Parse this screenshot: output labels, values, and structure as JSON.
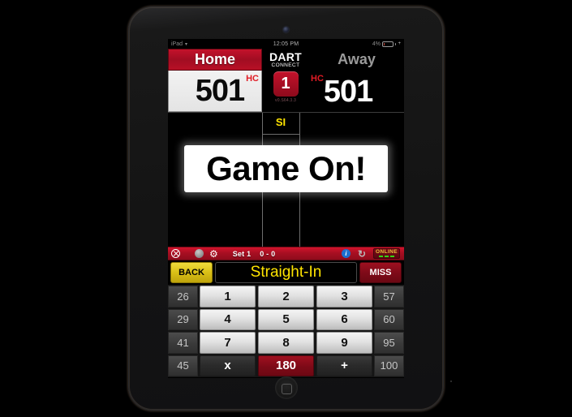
{
  "status_bar": {
    "device": "iPad",
    "wifi_icon": "wifi-icon",
    "time": "12:05 PM",
    "battery_percent": "4%"
  },
  "scoreboard": {
    "home_label": "Home",
    "home_score": "501",
    "home_hc": "HC",
    "brand_top": "DART",
    "brand_bottom": "CONNECT",
    "leg_number": "1",
    "version": "v0.S64.3.3",
    "away_hc": "HC",
    "away_label": "Away",
    "away_score": "501"
  },
  "game_area": {
    "column_marker": "SI",
    "banner_text": "Game On!"
  },
  "toolbar": {
    "close_icon": "close-circle-icon",
    "circle_icon": "circle-icon",
    "gear_icon": "gear-icon",
    "set_label": "Set 1",
    "set_score": "0 - 0",
    "info_icon": "info-icon",
    "refresh_icon": "refresh-icon",
    "online_label": "ONLINE",
    "signal_bars": 3
  },
  "action_row": {
    "back_label": "BACK",
    "mode_label": "Straight-In",
    "miss_label": "MISS"
  },
  "keypad": {
    "rows": [
      {
        "left": "26",
        "keys": [
          "1",
          "2",
          "3"
        ],
        "right": "57"
      },
      {
        "left": "29",
        "keys": [
          "4",
          "5",
          "6"
        ],
        "right": "60"
      },
      {
        "left": "41",
        "keys": [
          "7",
          "8",
          "9"
        ],
        "right": "95"
      },
      {
        "left": "45",
        "keys": [
          "x",
          "180",
          "+"
        ],
        "right": "100"
      }
    ]
  },
  "colors": {
    "brand_red": "#c3122b",
    "accent_yellow": "#ffe400",
    "online_green": "#37d215",
    "info_blue": "#1c6fd0"
  }
}
